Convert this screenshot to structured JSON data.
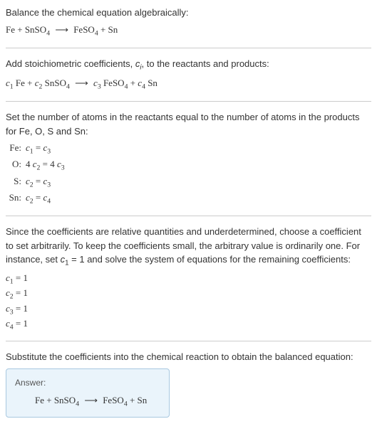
{
  "section1": {
    "title": "Balance the chemical equation algebraically:",
    "lhs1": "Fe + SnSO",
    "lhs1_sub": "4",
    "rhs1": "FeSO",
    "rhs1_sub": "4",
    "rhs2": " + Sn"
  },
  "section2": {
    "title_a": "Add stoichiometric coefficients, ",
    "title_b": ", to the reactants and products:",
    "var": "c",
    "var_sub": "i",
    "c1": "c",
    "c1s": "1",
    "t1": " Fe + ",
    "c2": "c",
    "c2s": "2",
    "t2": " SnSO",
    "t2s": "4",
    "c3": "c",
    "c3s": "3",
    "t3": " FeSO",
    "t3s": "4",
    "t3b": " + ",
    "c4": "c",
    "c4s": "4",
    "t4": " Sn"
  },
  "section3": {
    "title": "Set the number of atoms in the reactants equal to the number of atoms in the products for Fe, O, S and Sn:",
    "rows": [
      {
        "label": "Fe:",
        "lhs": "c",
        "lhs_s": "1",
        "eq": " = ",
        "rhs": "c",
        "rhs_s": "3"
      },
      {
        "label": "O:",
        "lhs_pre": "4 ",
        "lhs": "c",
        "lhs_s": "2",
        "eq": " = 4 ",
        "rhs": "c",
        "rhs_s": "3"
      },
      {
        "label": "S:",
        "lhs": "c",
        "lhs_s": "2",
        "eq": " = ",
        "rhs": "c",
        "rhs_s": "3"
      },
      {
        "label": "Sn:",
        "lhs": "c",
        "lhs_s": "2",
        "eq": " = ",
        "rhs": "c",
        "rhs_s": "4"
      }
    ]
  },
  "section4": {
    "text_a": "Since the coefficients are relative quantities and underdetermined, choose a coefficient to set arbitrarily. To keep the coefficients small, the arbitrary value is ordinarily one. For instance, set ",
    "var": "c",
    "var_s": "1",
    "text_b": " = 1 and solve the system of equations for the remaining coefficients:",
    "coefs": [
      {
        "c": "c",
        "s": "1",
        "eq": " = 1"
      },
      {
        "c": "c",
        "s": "2",
        "eq": " = 1"
      },
      {
        "c": "c",
        "s": "3",
        "eq": " = 1"
      },
      {
        "c": "c",
        "s": "4",
        "eq": " = 1"
      }
    ]
  },
  "section5": {
    "title": "Substitute the coefficients into the chemical reaction to obtain the balanced equation:",
    "answer_label": "Answer:",
    "lhs1": "Fe + SnSO",
    "lhs1_sub": "4",
    "rhs1": "FeSO",
    "rhs1_sub": "4",
    "rhs2": " + Sn"
  },
  "arrow": "⟶"
}
